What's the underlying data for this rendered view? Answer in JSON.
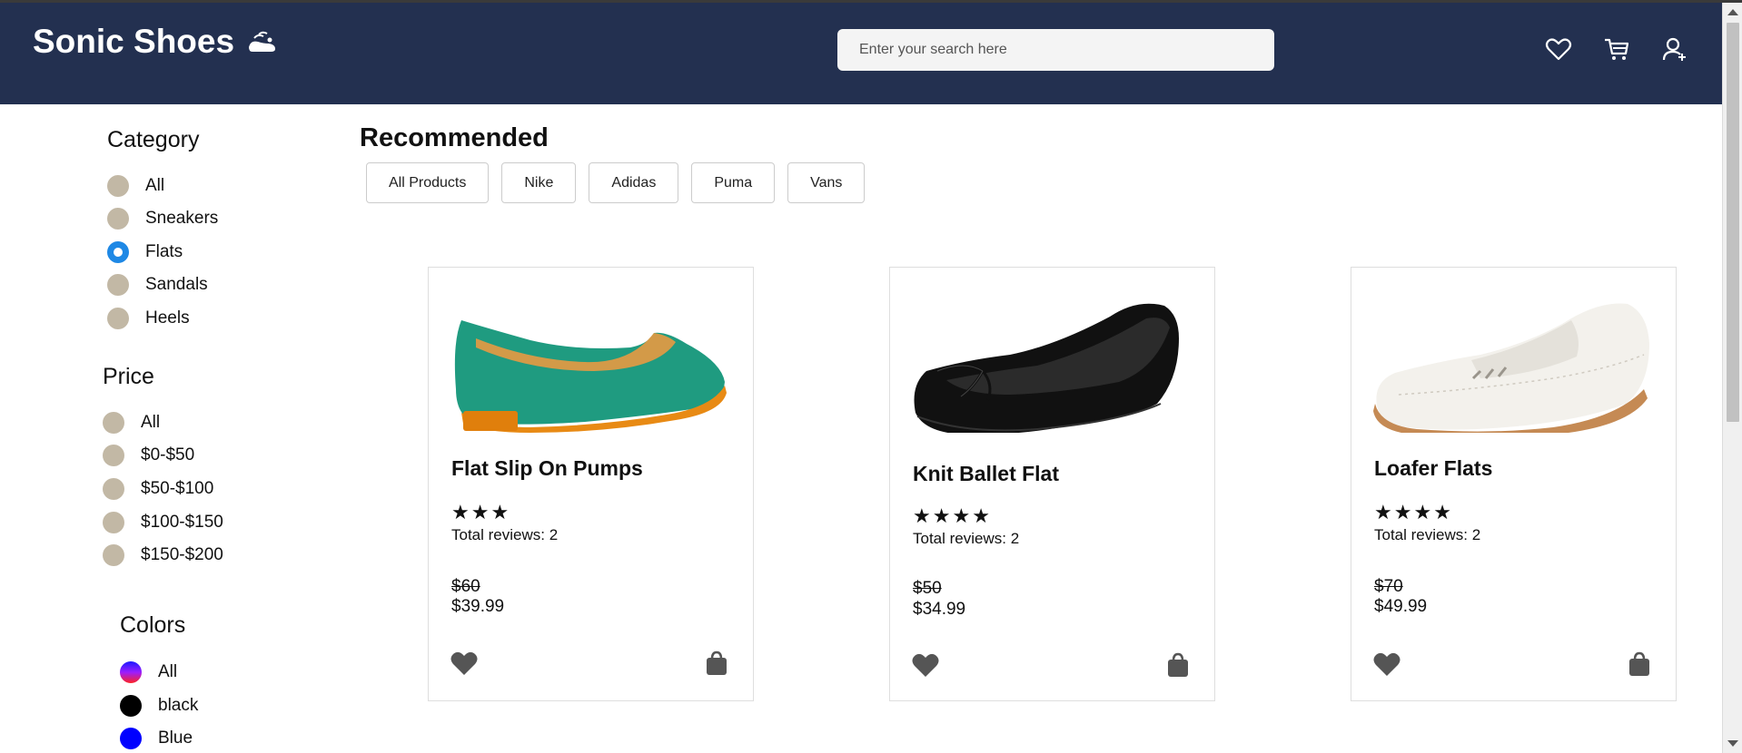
{
  "header": {
    "brand": "Sonic Shoes",
    "search_placeholder": "Enter your search here",
    "bg_color": "#233050",
    "icons": [
      "heart-icon",
      "cart-icon",
      "user-add-icon"
    ]
  },
  "sidebar": {
    "category": {
      "title": "Category",
      "options": [
        "All",
        "Sneakers",
        "Flats",
        "Sandals",
        "Heels"
      ],
      "selected": "Flats"
    },
    "price": {
      "title": "Price",
      "options": [
        "All",
        "$0-$50",
        "$50-$100",
        "$100-$150",
        "$150-$200"
      ]
    },
    "colors": {
      "title": "Colors",
      "options": [
        {
          "label": "All",
          "color": "gradient-purple-red"
        },
        {
          "label": "black",
          "color": "#000000"
        },
        {
          "label": "Blue",
          "color": "#0000ff"
        }
      ]
    }
  },
  "main": {
    "title": "Recommended",
    "filters": [
      "All Products",
      "Nike",
      "Adidas",
      "Puma",
      "Vans"
    ]
  },
  "products": [
    {
      "name": "Flat Slip On Pumps",
      "stars": 3,
      "reviews": "Total reviews: 2",
      "old_price": "$60",
      "price": "$39.99",
      "image": "green-suede-flat"
    },
    {
      "name": "Knit Ballet Flat",
      "stars": 4,
      "reviews": "Total reviews: 2",
      "old_price": "$50",
      "price": "$34.99",
      "image": "black-leather-ballet-flat"
    },
    {
      "name": "Loafer Flats",
      "stars": 4,
      "reviews": "Total reviews: 2",
      "old_price": "$70",
      "price": "$49.99",
      "image": "white-loafer"
    }
  ],
  "colors": {
    "accent": "#1e88e5",
    "radio": "#c2b8a5"
  }
}
